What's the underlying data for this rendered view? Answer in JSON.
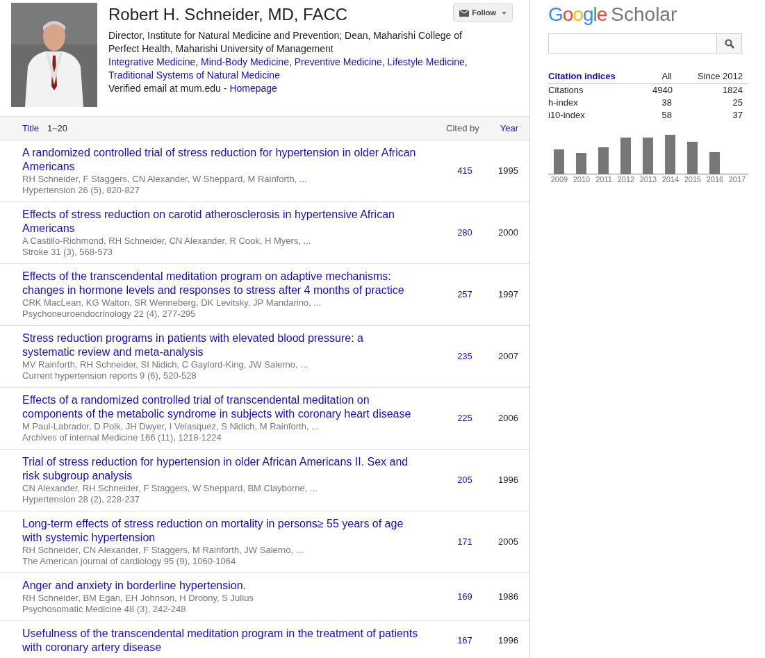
{
  "profile": {
    "name": "Robert H. Schneider, MD, FACC",
    "affiliation": "Director, Institute for Natural Medicine and Prevention; Dean, Maharishi College of Perfect Health, Maharishi University of Management",
    "interest_separator": ",",
    "interests": [
      "Integrative Medicine",
      "Mind-Body Medicine",
      "Preventive Medicine",
      "Lifestyle Medicine",
      "Traditional Systems of Natural Medicine"
    ],
    "verified": "Verified email at mum.edu -",
    "homepage": "Homepage",
    "follow": "Follow"
  },
  "table": {
    "columns": {
      "title": "Title",
      "range": "1–20",
      "cited_by": "Cited by",
      "year": "Year"
    },
    "rows": [
      {
        "title": "A randomized controlled trial of stress reduction for hypertension in older African Americans",
        "authors": "RH Schneider, F Staggers, CN Alexander, W Sheppard, M Rainforth, ...",
        "venue": "Hypertension 26 (5), 820-827",
        "cited_by": "415",
        "year": "1995"
      },
      {
        "title": "Effects of stress reduction on carotid atherosclerosis in hypertensive African Americans",
        "authors": "A Castillo-Richmond, RH Schneider, CN Alexander, R Cook, H Myers, ...",
        "venue": "Stroke 31 (3), 568-573",
        "cited_by": "280",
        "year": "2000"
      },
      {
        "title": "Effects of the transcendental meditation program on adaptive mechanisms: changes in hormone levels and responses to stress after 4 months of practice",
        "authors": "CRK MacLean, KG Walton, SR Wenneberg, DK Levitsky, JP Mandarino, ...",
        "venue": "Psychoneuroendocrinology 22 (4), 277-295",
        "cited_by": "257",
        "year": "1997"
      },
      {
        "title": "Stress reduction programs in patients with elevated blood pressure: a systematic review and meta-analysis",
        "authors": "MV Rainforth, RH Schneider, SI Nidich, C Gaylord-King, JW Salerno, ...",
        "venue": "Current hypertension reports 9 (6), 520-528",
        "cited_by": "235",
        "year": "2007"
      },
      {
        "title": "Effects of a randomized controlled trial of transcendental meditation on components of the metabolic syndrome in subjects with coronary heart disease",
        "authors": "M Paul-Labrador, D Polk, JH Dwyer, I Velasquez, S Nidich, M Rainforth, ...",
        "venue": "Archives of internal Medicine 166 (11), 1218-1224",
        "cited_by": "225",
        "year": "2006"
      },
      {
        "title": "Trial of stress reduction for hypertension in older African Americans II. Sex and risk subgroup analysis",
        "authors": "CN Alexander, RH Schneider, F Staggers, W Sheppard, BM Clayborne, ...",
        "venue": "Hypertension 28 (2), 228-237",
        "cited_by": "205",
        "year": "1996"
      },
      {
        "title": "Long-term effects of stress reduction on mortality in persons≥ 55 years of age with systemic hypertension",
        "authors": "RH Schneider, CN Alexander, F Staggers, M Rainforth, JW Salerno, ...",
        "venue": "The American journal of cardiology 95 (9), 1060-1064",
        "cited_by": "171",
        "year": "2005"
      },
      {
        "title": "Anger and anxiety in borderline hypertension.",
        "authors": "RH Schneider, BM Egan, EH Johnson, H Drobny, S Julius",
        "venue": "Psychosomatic Medicine 48 (3), 242-248",
        "cited_by": "169",
        "year": "1986"
      },
      {
        "title": "Usefulness of the transcendental meditation program in the treatment of patients with coronary artery disease",
        "cited_by": "167",
        "year": "1996"
      }
    ]
  },
  "sidebar": {
    "logo_google": "Google",
    "logo_scholar": "Scholar",
    "indices": {
      "header": [
        "Citation indices",
        "All",
        "Since 2012"
      ],
      "rows": [
        [
          "Citations",
          "4940",
          "1824"
        ],
        [
          "h-index",
          "38",
          "25"
        ],
        [
          "i10-index",
          "58",
          "37"
        ]
      ]
    },
    "years": [
      "2009",
      "2010",
      "2011",
      "2012",
      "2013",
      "2014",
      "2015",
      "2016",
      "2017"
    ]
  }
}
